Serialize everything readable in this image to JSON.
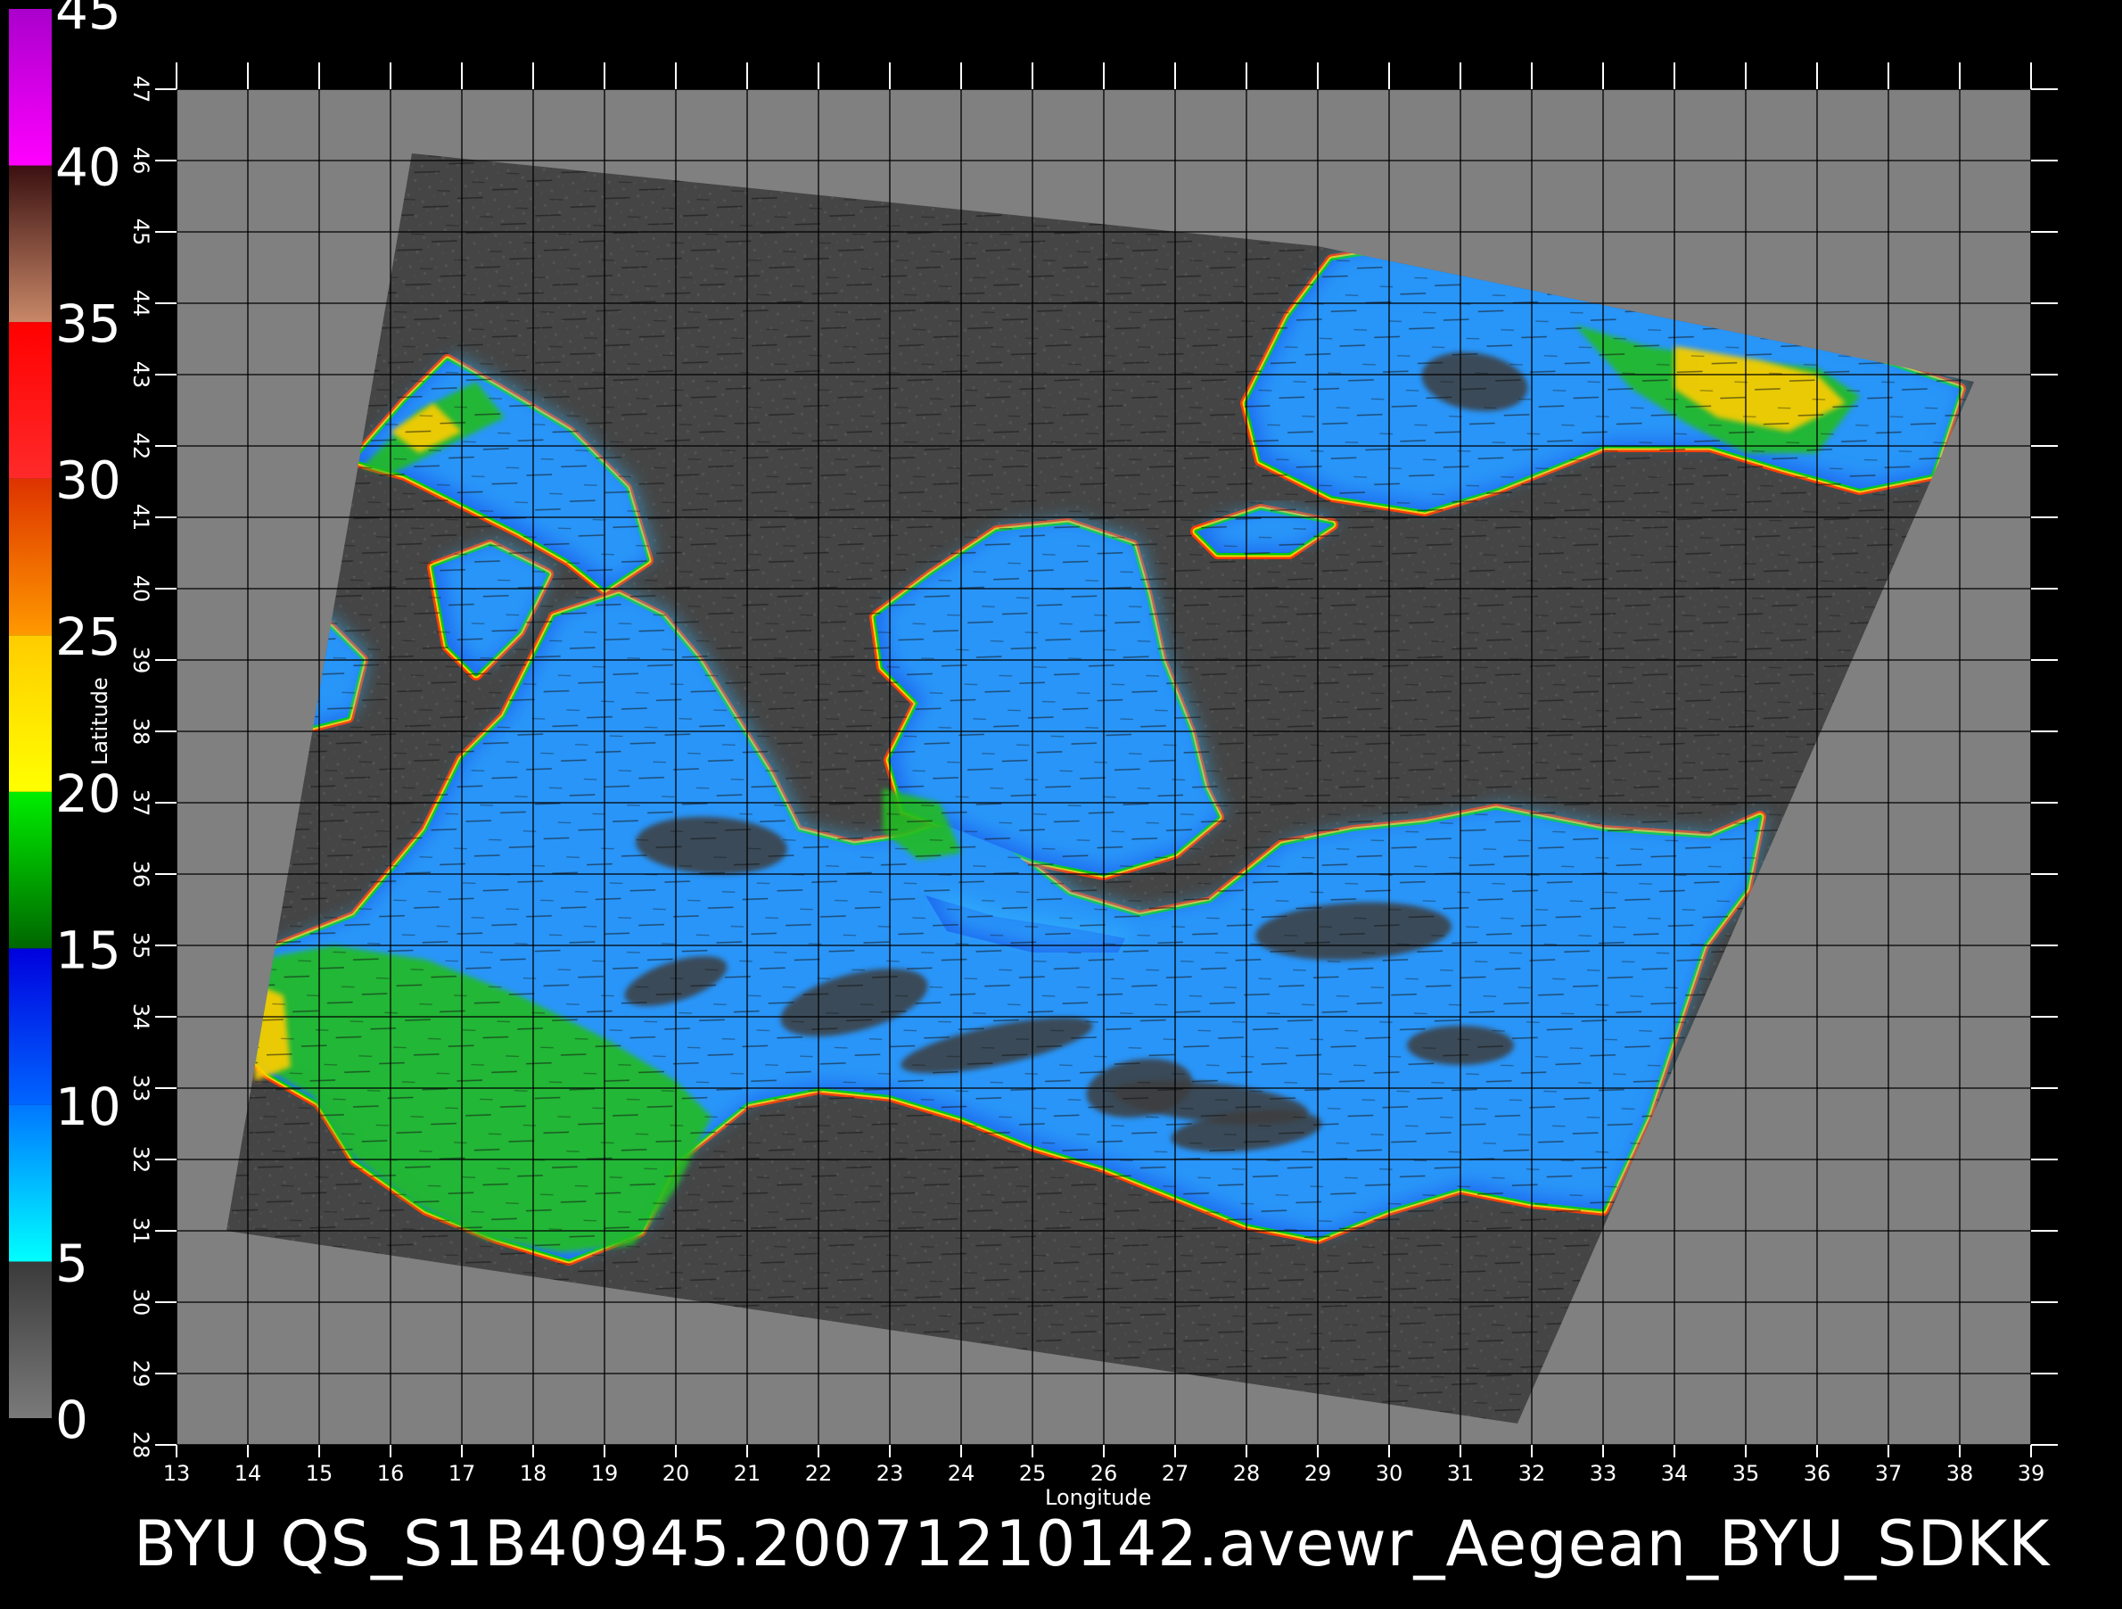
{
  "title": "BYU  QS_S1B40945.20071210142.avewr_Aegean_BYU_SDKK",
  "colorbar": {
    "labels": [
      "0",
      "5",
      "10",
      "15",
      "20",
      "25",
      "30",
      "35",
      "40",
      "45"
    ],
    "bands": [
      {
        "from": 0,
        "to": 5,
        "colors": [
          "#7a7a7a",
          "#3a3a3a"
        ]
      },
      {
        "from": 5,
        "to": 10,
        "colors": [
          "#00ffff",
          "#0077ff"
        ]
      },
      {
        "from": 10,
        "to": 15,
        "colors": [
          "#0066ff",
          "#0000dd"
        ]
      },
      {
        "from": 15,
        "to": 20,
        "colors": [
          "#006600",
          "#00ee00"
        ]
      },
      {
        "from": 20,
        "to": 25,
        "colors": [
          "#ffff00",
          "#ffcc00"
        ]
      },
      {
        "from": 25,
        "to": 30,
        "colors": [
          "#ff9900",
          "#dd3300"
        ]
      },
      {
        "from": 30,
        "to": 35,
        "colors": [
          "#ff2a2a",
          "#ff0000"
        ]
      },
      {
        "from": 35,
        "to": 40,
        "colors": [
          "#c88868",
          "#3a1010"
        ]
      },
      {
        "from": 40,
        "to": 45,
        "colors": [
          "#ff00ff",
          "#aa00cc"
        ]
      }
    ]
  },
  "axes": {
    "xlabel": "Longitude",
    "ylabel": "Latitude",
    "lon_ticks": [
      "13",
      "14",
      "15",
      "16",
      "17",
      "18",
      "19",
      "20",
      "21",
      "22",
      "23",
      "24",
      "25",
      "26",
      "27",
      "28",
      "29",
      "30",
      "31",
      "32",
      "33",
      "34",
      "35",
      "36",
      "37",
      "38",
      "39"
    ],
    "lat_ticks": [
      "28",
      "29",
      "30",
      "31",
      "32",
      "33",
      "34",
      "35",
      "36",
      "37",
      "38",
      "39",
      "40",
      "41",
      "42",
      "43",
      "44",
      "45",
      "46",
      "47"
    ],
    "lon_range": [
      13,
      39
    ],
    "lat_range": [
      28,
      47
    ]
  },
  "colors": {
    "background": "#000000",
    "plot_background": "#808080",
    "swath": "#454545",
    "land_mask": "#454545",
    "grid": "#000000"
  },
  "map": {
    "swath_corners_lonlat": [
      [
        16.3,
        46.1
      ],
      [
        29,
        44.8
      ],
      [
        38.2,
        42.9
      ],
      [
        31.8,
        28.3
      ],
      [
        13.7,
        31.0
      ]
    ],
    "seas": [
      {
        "name": "central-med",
        "outline": [
          [
            14,
            34.8
          ],
          [
            15.5,
            35.4
          ],
          [
            16.5,
            36.6
          ],
          [
            17,
            37.6
          ],
          [
            17.6,
            38.2
          ],
          [
            18.3,
            39.6
          ],
          [
            19.2,
            39.9
          ],
          [
            19.8,
            39.6
          ],
          [
            20.3,
            39.0
          ],
          [
            20.8,
            38.2
          ],
          [
            21.3,
            37.4
          ],
          [
            21.7,
            36.6
          ],
          [
            22.5,
            36.4
          ],
          [
            23.2,
            36.5
          ],
          [
            23.8,
            36.7
          ],
          [
            24.6,
            36.4
          ],
          [
            25.5,
            35.7
          ],
          [
            26.5,
            35.4
          ],
          [
            27.5,
            35.6
          ],
          [
            28.5,
            36.4
          ],
          [
            29.5,
            36.6
          ],
          [
            30.5,
            36.7
          ],
          [
            31.5,
            36.9
          ],
          [
            33,
            36.6
          ],
          [
            34.5,
            36.5
          ],
          [
            35.2,
            36.8
          ],
          [
            35.0,
            35.8
          ],
          [
            34.4,
            35.0
          ],
          [
            34.0,
            33.8
          ],
          [
            33.6,
            32.6
          ],
          [
            33.0,
            31.3
          ],
          [
            32.0,
            31.4
          ],
          [
            31.0,
            31.6
          ],
          [
            30.0,
            31.3
          ],
          [
            29.0,
            30.9
          ],
          [
            28.0,
            31.1
          ],
          [
            27.0,
            31.5
          ],
          [
            26.0,
            31.9
          ],
          [
            25.0,
            32.2
          ],
          [
            24.0,
            32.6
          ],
          [
            23.0,
            32.9
          ],
          [
            22.0,
            33.0
          ],
          [
            21.0,
            32.8
          ],
          [
            20.0,
            32.0
          ],
          [
            19.5,
            31.0
          ],
          [
            18.5,
            30.6
          ],
          [
            17.5,
            30.9
          ],
          [
            16.5,
            31.3
          ],
          [
            15.5,
            32.0
          ],
          [
            15.0,
            32.8
          ],
          [
            14.3,
            33.2
          ],
          [
            13.9,
            33.6
          ]
        ]
      },
      {
        "name": "adriatic",
        "outline": [
          [
            15.5,
            41.8
          ],
          [
            16.2,
            42.6
          ],
          [
            16.8,
            43.2
          ],
          [
            17.5,
            42.8
          ],
          [
            18.5,
            42.2
          ],
          [
            19.3,
            41.4
          ],
          [
            19.6,
            40.4
          ],
          [
            19.0,
            40.0
          ],
          [
            18.5,
            40.4
          ],
          [
            17.8,
            40.8
          ],
          [
            17.0,
            41.2
          ],
          [
            16.2,
            41.6
          ]
        ]
      },
      {
        "name": "ionian-north",
        "outline": [
          [
            16.6,
            40.3
          ],
          [
            17.4,
            40.6
          ],
          [
            18.2,
            40.2
          ],
          [
            17.8,
            39.4
          ],
          [
            17.2,
            38.8
          ],
          [
            16.8,
            39.2
          ]
        ]
      },
      {
        "name": "tyrrhenian-edge",
        "outline": [
          [
            14.0,
            39.4
          ],
          [
            15.0,
            39.6
          ],
          [
            15.6,
            39.0
          ],
          [
            15.4,
            38.2
          ],
          [
            14.6,
            38.0
          ],
          [
            14.0,
            38.6
          ]
        ]
      },
      {
        "name": "aegean",
        "outline": [
          [
            22.8,
            39.6
          ],
          [
            23.6,
            40.2
          ],
          [
            24.5,
            40.8
          ],
          [
            25.5,
            40.9
          ],
          [
            26.4,
            40.6
          ],
          [
            26.6,
            39.9
          ],
          [
            26.8,
            39.0
          ],
          [
            27.2,
            38.0
          ],
          [
            27.4,
            37.2
          ],
          [
            27.6,
            36.8
          ],
          [
            27.0,
            36.3
          ],
          [
            26.0,
            36.0
          ],
          [
            25.0,
            36.2
          ],
          [
            24.0,
            36.6
          ],
          [
            23.2,
            36.9
          ],
          [
            23.0,
            37.6
          ],
          [
            23.4,
            38.4
          ],
          [
            22.9,
            38.9
          ]
        ]
      },
      {
        "name": "marmara",
        "outline": [
          [
            27.3,
            40.8
          ],
          [
            28.2,
            41.1
          ],
          [
            29.2,
            40.9
          ],
          [
            28.6,
            40.5
          ],
          [
            27.6,
            40.5
          ]
        ]
      },
      {
        "name": "black-sea",
        "outline": [
          [
            28.0,
            42.6
          ],
          [
            28.6,
            43.8
          ],
          [
            29.2,
            44.6
          ],
          [
            30.5,
            44.8
          ],
          [
            32.0,
            44.6
          ],
          [
            33.5,
            44.4
          ],
          [
            35.0,
            43.9
          ],
          [
            36.5,
            43.3
          ],
          [
            38.0,
            42.8
          ],
          [
            37.6,
            41.6
          ],
          [
            36.6,
            41.4
          ],
          [
            35.5,
            41.7
          ],
          [
            34.5,
            42.0
          ],
          [
            33.0,
            42.0
          ],
          [
            31.5,
            41.4
          ],
          [
            30.5,
            41.1
          ],
          [
            29.2,
            41.3
          ],
          [
            28.2,
            41.8
          ]
        ]
      },
      {
        "name": "crete-gap",
        "outline": [
          [
            23.5,
            35.7
          ],
          [
            24.5,
            35.4
          ],
          [
            25.8,
            35.2
          ],
          [
            26.3,
            35.1
          ],
          [
            26.2,
            34.9
          ],
          [
            25.0,
            34.9
          ],
          [
            23.8,
            35.2
          ]
        ]
      }
    ],
    "green_zones": [
      {
        "outline": [
          [
            14.1,
            34.8
          ],
          [
            15.2,
            35.0
          ],
          [
            16.5,
            34.8
          ],
          [
            17.8,
            34.3
          ],
          [
            19.0,
            33.7
          ],
          [
            20.0,
            33.1
          ],
          [
            20.5,
            32.6
          ],
          [
            20.0,
            31.6
          ],
          [
            19.4,
            30.8
          ],
          [
            18.4,
            30.7
          ],
          [
            17.3,
            30.9
          ],
          [
            16.3,
            31.4
          ],
          [
            15.4,
            32.1
          ],
          [
            14.9,
            32.9
          ],
          [
            14.2,
            33.3
          ],
          [
            13.9,
            33.8
          ]
        ]
      },
      {
        "outline": [
          [
            15.6,
            41.7
          ],
          [
            16.4,
            42.5
          ],
          [
            17.2,
            42.9
          ],
          [
            17.6,
            42.4
          ],
          [
            16.8,
            42.0
          ],
          [
            16.0,
            41.6
          ]
        ]
      },
      {
        "outline": [
          [
            32.6,
            43.7
          ],
          [
            33.6,
            43.4
          ],
          [
            34.8,
            43.2
          ],
          [
            36.0,
            43.1
          ],
          [
            36.6,
            42.7
          ],
          [
            36.0,
            41.9
          ],
          [
            35.0,
            41.9
          ],
          [
            34.2,
            42.3
          ],
          [
            33.4,
            42.8
          ]
        ]
      },
      {
        "outline": [
          [
            22.9,
            37.2
          ],
          [
            23.7,
            37.0
          ],
          [
            24.0,
            36.3
          ],
          [
            23.4,
            36.2
          ],
          [
            22.9,
            36.6
          ]
        ]
      }
    ],
    "yellow_zones": [
      {
        "outline": [
          [
            14.0,
            34.5
          ],
          [
            14.5,
            34.3
          ],
          [
            14.6,
            33.3
          ],
          [
            14.1,
            33.1
          ]
        ]
      },
      {
        "outline": [
          [
            34.0,
            43.4
          ],
          [
            35.2,
            43.2
          ],
          [
            36.0,
            43.0
          ],
          [
            36.4,
            42.6
          ],
          [
            35.6,
            42.2
          ],
          [
            34.6,
            42.4
          ],
          [
            34.0,
            42.8
          ]
        ]
      },
      {
        "outline": [
          [
            16.0,
            42.2
          ],
          [
            16.6,
            42.6
          ],
          [
            17.0,
            42.2
          ],
          [
            16.4,
            41.9
          ]
        ]
      }
    ]
  }
}
